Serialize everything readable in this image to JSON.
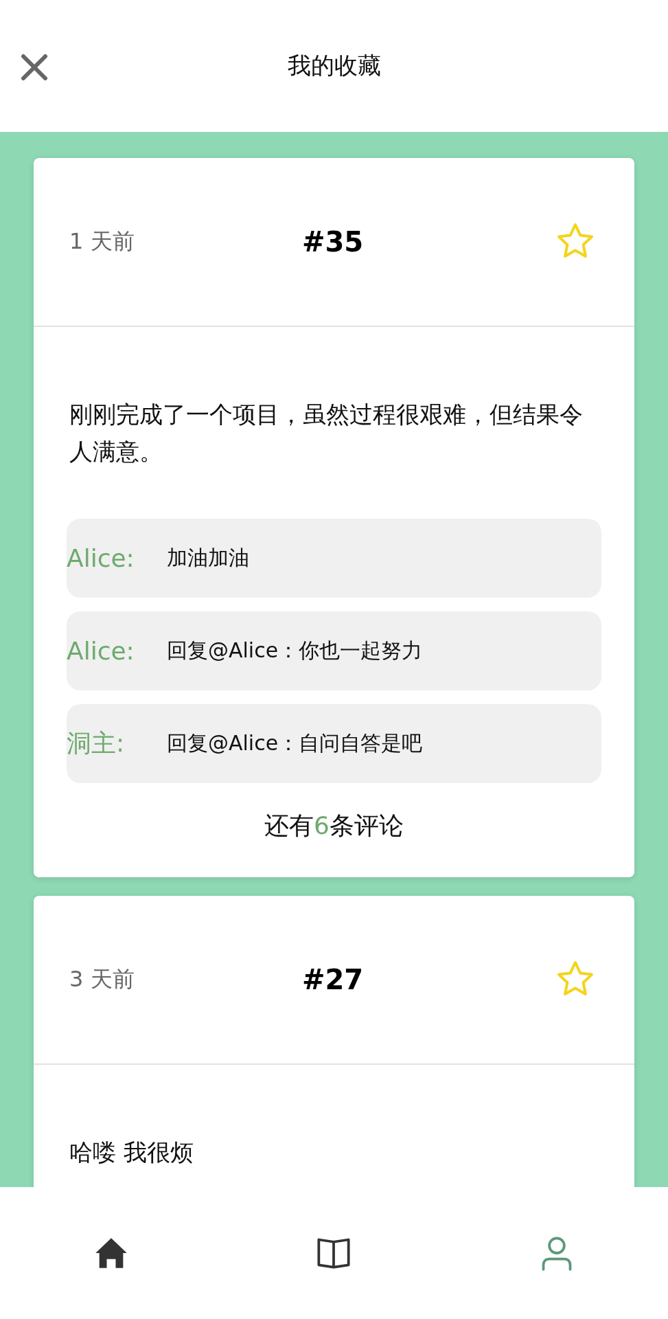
{
  "header": {
    "title": "我的收藏"
  },
  "posts": [
    {
      "time": "1 天前",
      "number": "#35",
      "favorited": true,
      "text": "刚刚完成了一个项目，虽然过程很艰难，但结果令人满意。",
      "comments": [
        {
          "author": "Alice:",
          "text": "加油加油"
        },
        {
          "author": "Alice:",
          "text": "回复@Alice：你也一起努力"
        },
        {
          "author": "洞主:",
          "text": "回复@Alice：自问自答是吧"
        }
      ],
      "more_comments": {
        "before": "还有",
        "count": "6",
        "after": "条评论"
      }
    },
    {
      "time": "3 天前",
      "number": "#27",
      "favorited": true,
      "text": "哈喽 我很烦"
    }
  ],
  "nav": [
    {
      "kind": "home",
      "selected": false
    },
    {
      "kind": "book",
      "selected": false
    },
    {
      "kind": "user",
      "selected": true
    }
  ]
}
